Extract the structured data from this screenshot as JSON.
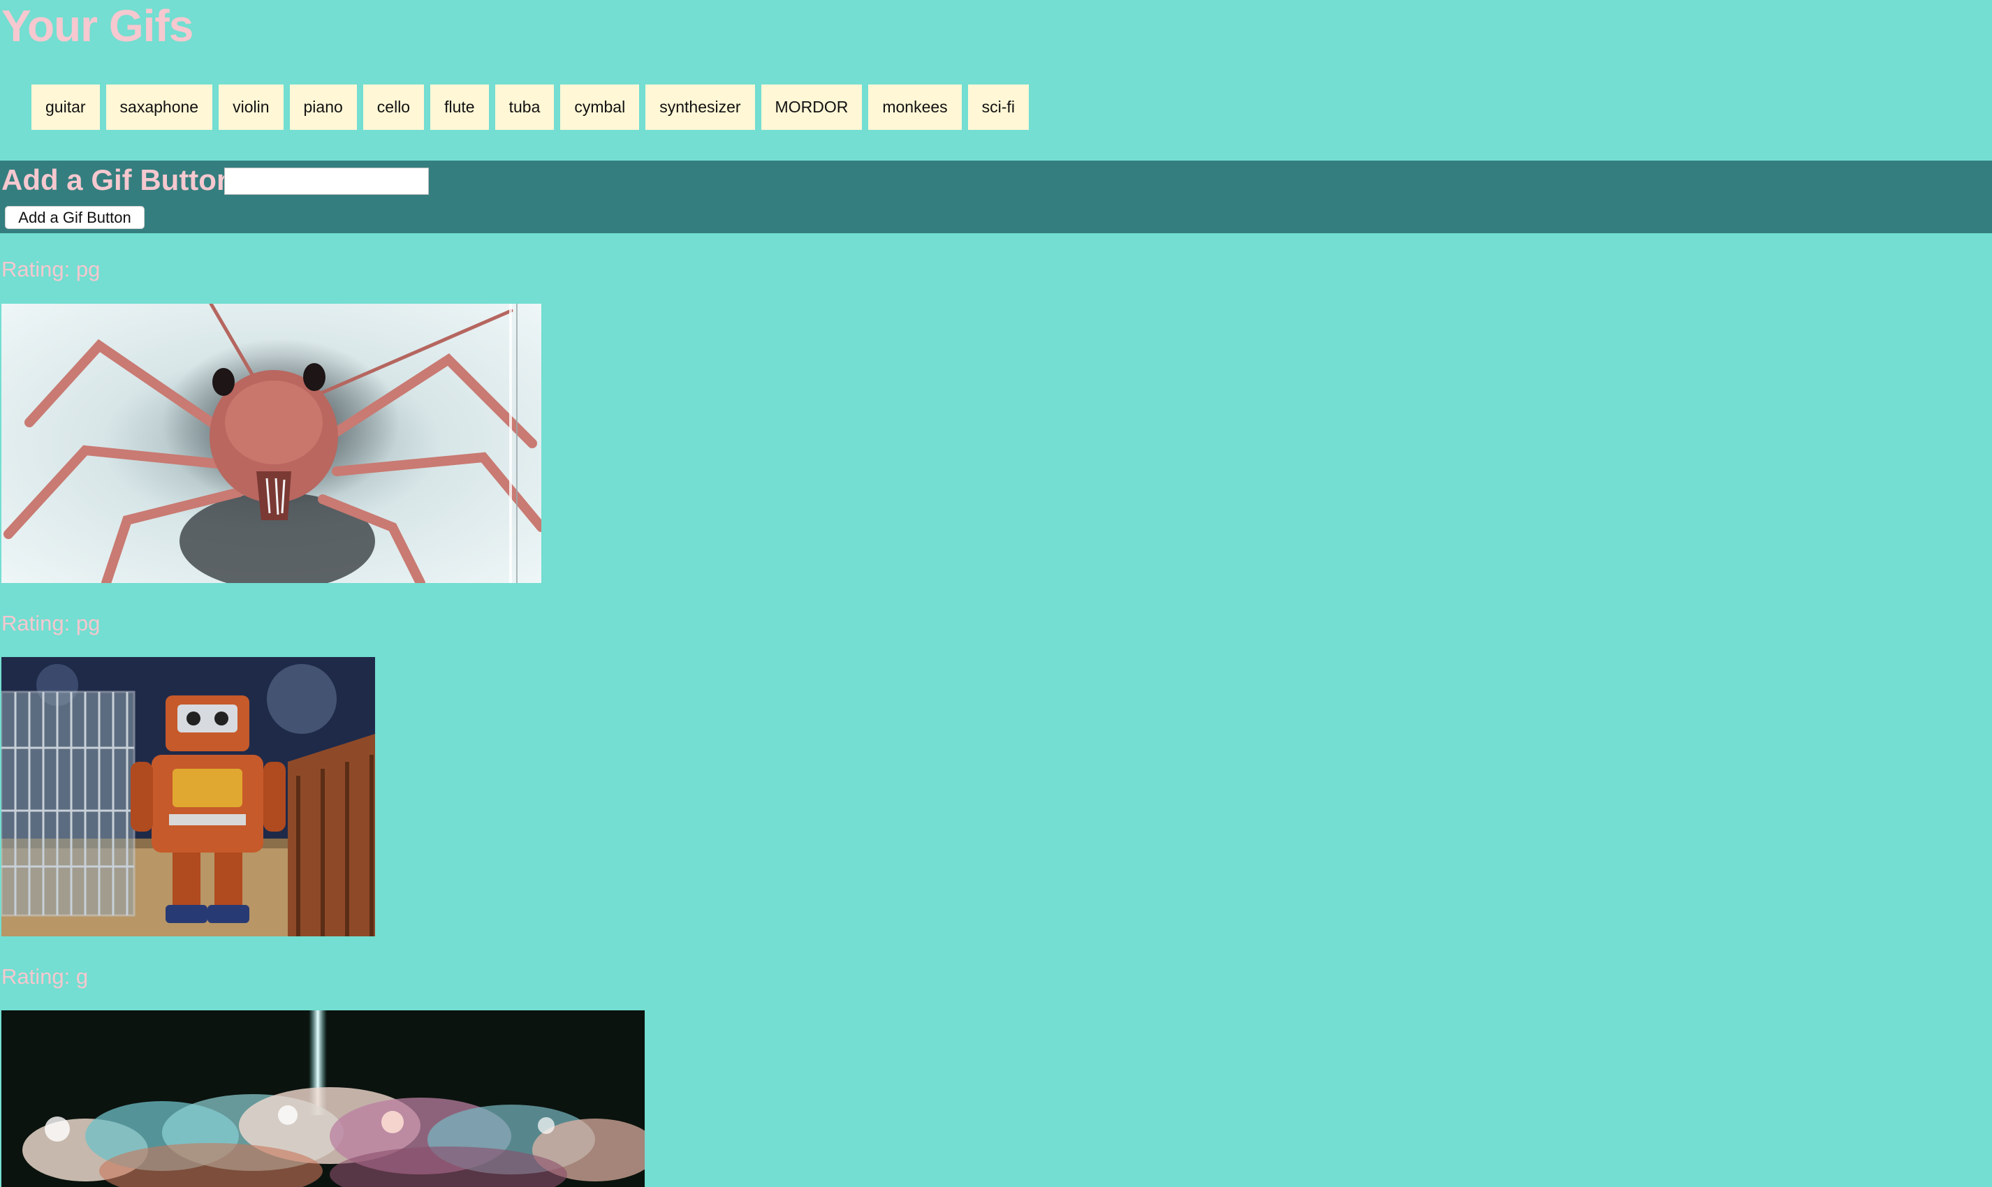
{
  "page": {
    "title": "Your Gifs"
  },
  "topics": [
    "guitar",
    "saxaphone",
    "violin",
    "piano",
    "cello",
    "flute",
    "tuba",
    "cymbal",
    "synthesizer",
    "MORDOR",
    "monkees",
    "sci-fi"
  ],
  "add_form": {
    "heading": "Add a Gif Button",
    "input_value": "",
    "submit_label": "Add a Gif Button"
  },
  "gifs": [
    {
      "rating": "Rating: pg",
      "subject": "giant ant close-up"
    },
    {
      "rating": "Rating: pg",
      "subject": "toy robot"
    },
    {
      "rating": "Rating: g",
      "subject": "nebula explosion"
    }
  ],
  "colors": {
    "background": "#73ded1",
    "accent_pink": "#f6c8cf",
    "panel": "#347e7f",
    "topic_button": "#fff7d6"
  }
}
